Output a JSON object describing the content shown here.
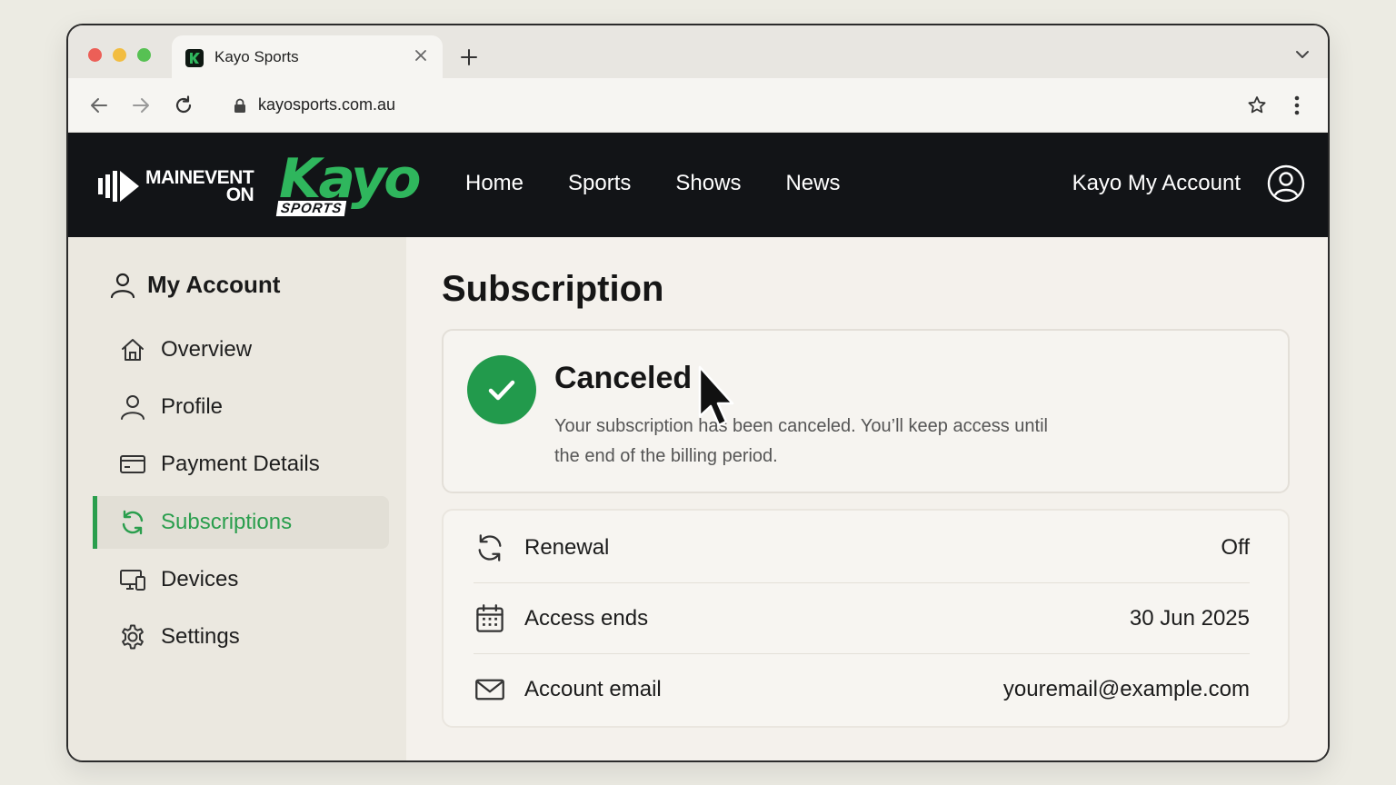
{
  "browser": {
    "tab_title": "Kayo Sports",
    "url": "kayosports.com.au"
  },
  "header": {
    "partner_logo_line1": "MAINEVENT",
    "partner_logo_line2": "ON",
    "brand_word": "Kayo",
    "brand_sub": "SPORTS",
    "nav": [
      "Home",
      "Sports",
      "Shows",
      "News"
    ],
    "account_link": "Kayo My Account"
  },
  "sidebar": {
    "heading": "My Account",
    "items": [
      {
        "label": "Overview",
        "icon": "home-icon"
      },
      {
        "label": "Profile",
        "icon": "user-icon"
      },
      {
        "label": "Payment Details",
        "icon": "credit-card-icon"
      },
      {
        "label": "Subscriptions",
        "icon": "refresh-icon",
        "active": true
      },
      {
        "label": "Devices",
        "icon": "devices-icon"
      },
      {
        "label": "Settings",
        "icon": "gear-icon"
      }
    ]
  },
  "main": {
    "title": "Subscription",
    "status": {
      "title": "Canceled",
      "message": "Your subscription has been canceled. You’ll keep access until the end of the billing period."
    },
    "details": [
      {
        "label": "Renewal",
        "value": "Off",
        "icon": "refresh-icon"
      },
      {
        "label": "Access ends",
        "value": "30 Jun 2025",
        "icon": "calendar-icon"
      },
      {
        "label": "Account email",
        "value": "youremail@example.com",
        "icon": "mail-icon"
      }
    ]
  },
  "colors": {
    "accent": "#2a9e4d",
    "header_bg": "#121417",
    "kayo_green": "#2fb65d"
  }
}
